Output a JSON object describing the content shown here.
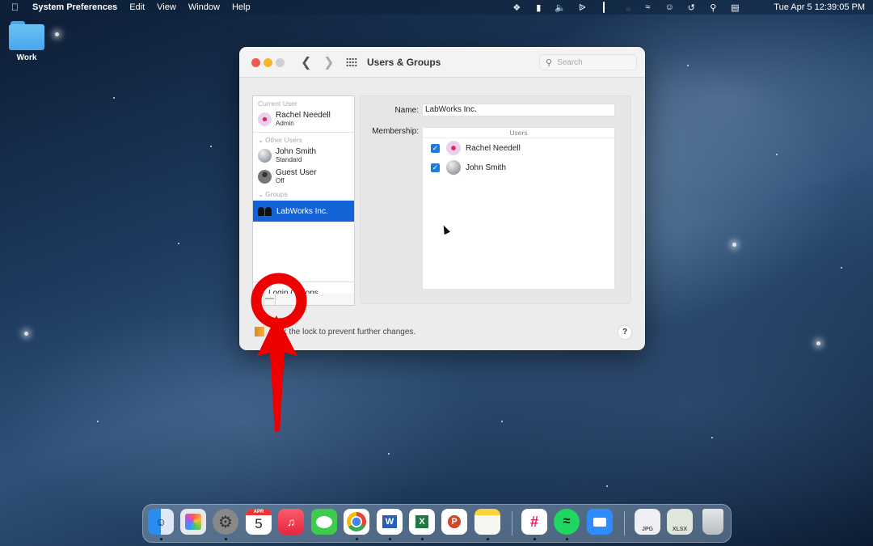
{
  "menubar": {
    "app_name": "System Preferences",
    "menus": [
      "Edit",
      "View",
      "Window",
      "Help"
    ],
    "status_icons": [
      "dropbox-icon",
      "contacts-card-icon",
      "volume-icon",
      "bluetooth-icon",
      "battery-icon",
      "us-flag-input-icon",
      "wifi-icon",
      "user-account-icon",
      "time-machine-icon",
      "spotlight-search-icon",
      "control-center-icon",
      "siri-icon"
    ],
    "clock": "Tue Apr 5  12:39:05 PM"
  },
  "desktop": {
    "folder_label": "Work"
  },
  "window": {
    "title": "Users & Groups",
    "search_placeholder": "Search",
    "sidebar": {
      "current_user_header": "Current User",
      "current_user": {
        "name": "Rachel Needell",
        "role": "Admin"
      },
      "other_users_header": "Other Users",
      "other_users": [
        {
          "name": "John Smith",
          "role": "Standard"
        },
        {
          "name": "Guest User",
          "role": "Off"
        }
      ],
      "groups_header": "Groups",
      "groups": [
        {
          "name": "LabWorks Inc.",
          "selected": true
        }
      ],
      "login_options": "Login Options",
      "add_label": "+",
      "remove_label": "—"
    },
    "detail": {
      "name_label": "Name:",
      "name_value": "LabWorks Inc.",
      "membership_label": "Membership:",
      "members_header": "Users",
      "members": [
        {
          "name": "Rachel Needell",
          "checked": true
        },
        {
          "name": "John Smith",
          "checked": true
        }
      ]
    },
    "lock_text": "Click the lock to prevent further changes.",
    "help_label": "?"
  },
  "annotation": {
    "color": "#ee0000",
    "target": "remove-button"
  },
  "dock": {
    "apps": [
      "Finder",
      "Launchpad",
      "System Preferences",
      "Calendar",
      "Music",
      "Messages",
      "Chrome",
      "Word",
      "Excel",
      "PowerPoint",
      "Notes",
      "Slack",
      "Spotify",
      "Zoom"
    ],
    "calendar_month": "APR",
    "calendar_day": "5",
    "files": [
      "JPG",
      "XLSX"
    ],
    "trash": "Trash"
  }
}
